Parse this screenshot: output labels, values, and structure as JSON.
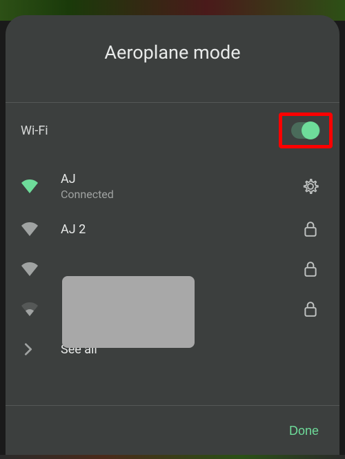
{
  "header": {
    "title": "Aeroplane mode"
  },
  "wifi": {
    "label": "Wi-Fi",
    "toggle_on": true
  },
  "networks": [
    {
      "name": "AJ",
      "status": "Connected",
      "signal": "full",
      "connected": true,
      "locked": false
    },
    {
      "name": "AJ 2",
      "status": "",
      "signal": "full",
      "connected": false,
      "locked": true
    },
    {
      "name": "",
      "status": "",
      "signal": "full",
      "connected": false,
      "locked": true
    },
    {
      "name": "",
      "status": "",
      "signal": "weak",
      "connected": false,
      "locked": true
    }
  ],
  "see_all": {
    "label": "See all"
  },
  "footer": {
    "done": "Done"
  },
  "colors": {
    "accent": "#6edc9a",
    "panel": "#3c3f3e",
    "text": "#e8eae9",
    "muted": "#a0a3a2"
  }
}
